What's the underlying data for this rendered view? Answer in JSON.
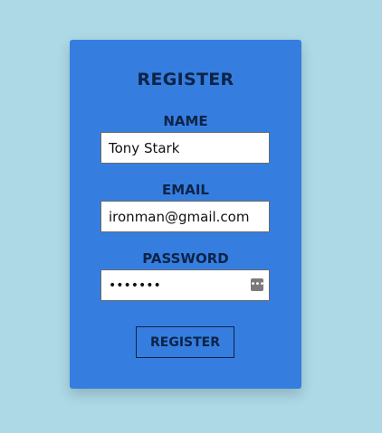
{
  "form": {
    "title": "REGISTER",
    "name_label": "NAME",
    "name_value": "Tony Stark",
    "email_label": "EMAIL",
    "email_value": "ironman@gmail.com",
    "password_label": "PASSWORD",
    "password_value": "•••••••",
    "password_icon": "password-manager-icon",
    "submit_label": "REGISTER"
  },
  "colors": {
    "background": "#add8e6",
    "card": "#357ee0",
    "text": "#0d2346"
  }
}
